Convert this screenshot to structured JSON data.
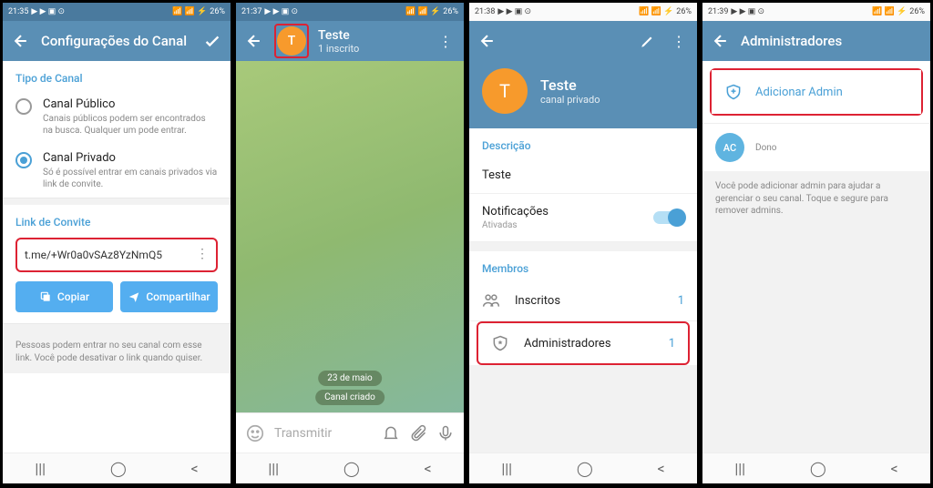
{
  "status": {
    "time1": "21:35",
    "time2": "21:37",
    "time3": "21:38",
    "time4": "21:39",
    "battery": "26%",
    "icons": "▶ ▶ ▣ ⊙",
    "sig": "📶 📶 ⚡"
  },
  "s1": {
    "title": "Configurações do Canal",
    "tipo": "Tipo de Canal",
    "pub": "Canal Público",
    "pub_desc": "Canais públicos podem ser encontrados na busca. Qualquer um pode entrar.",
    "priv": "Canal Privado",
    "priv_desc": "Só é possível entrar em canais privados via link de convite.",
    "link_label": "Link de Convite",
    "link": "t.me/+Wr0a0vSAz8YzNmQ5",
    "copy": "Copiar",
    "share": "Compartilhar",
    "hint": "Pessoas podem entrar no seu canal com esse link. Você pode desativar o link quando quiser."
  },
  "s2": {
    "name": "Teste",
    "sub": "1 inscrito",
    "avatar": "T",
    "date": "23 de maio",
    "created": "Canal criado",
    "placeholder": "Transmitir"
  },
  "s3": {
    "name": "Teste",
    "sub": "canal privado",
    "avatar": "T",
    "desc_label": "Descrição",
    "desc": "Teste",
    "notif": "Notificações",
    "notif_sub": "Ativadas",
    "members": "Membros",
    "subs": "Inscritos",
    "subs_n": "1",
    "admins": "Administradores",
    "admins_n": "1"
  },
  "s4": {
    "title": "Administradores",
    "add": "Adicionar Admin",
    "owner_initials": "AC",
    "owner": "Dono",
    "hint": "Você pode adicionar admin para ajudar a gerenciar o seu canal. Toque e segure para remover admins."
  }
}
